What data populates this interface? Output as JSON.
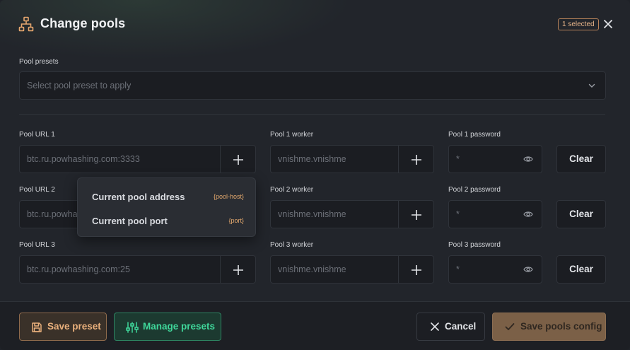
{
  "header": {
    "title": "Change pools",
    "selected_badge": "1 selected"
  },
  "presets": {
    "label": "Pool presets",
    "placeholder": "Select pool preset to apply"
  },
  "pools": [
    {
      "url_label": "Pool URL 1",
      "url_value": "btc.ru.powhashing.com:3333",
      "worker_label": "Pool 1 worker",
      "worker_value": "vnishme.vnishme",
      "password_label": "Pool 1 password",
      "password_value": "*",
      "clear_label": "Clear"
    },
    {
      "url_label": "Pool URL 2",
      "url_value": "btc.ru.powhas",
      "worker_label": "Pool 2 worker",
      "worker_value": "vnishme.vnishme",
      "password_label": "Pool 2 password",
      "password_value": "*",
      "clear_label": "Clear"
    },
    {
      "url_label": "Pool URL 3",
      "url_value": "btc.ru.powhashing.com:25",
      "worker_label": "Pool 3 worker",
      "worker_value": "vnishme.vnishme",
      "password_label": "Pool 3 password",
      "password_value": "*",
      "clear_label": "Clear"
    }
  ],
  "insert_menu": [
    {
      "label": "Current pool address",
      "tag": "{pool-host}"
    },
    {
      "label": "Current pool port",
      "tag": "{port}"
    }
  ],
  "footer": {
    "save_preset": "Save preset",
    "manage_presets": "Manage presets",
    "cancel": "Cancel",
    "save_config": "Save pools config"
  },
  "colors": {
    "accent_orange": "#e9b07c",
    "accent_green": "#3fd79a",
    "background": "#22252b"
  },
  "icons": {
    "title": "network-tree-icon",
    "close": "close-icon",
    "chevron": "chevron-down-icon",
    "plus": "plus-icon",
    "eye": "eye-icon",
    "save": "floppy-disk-icon",
    "manage": "sliders-icon",
    "cancel": "x-icon",
    "confirm": "check-icon"
  }
}
